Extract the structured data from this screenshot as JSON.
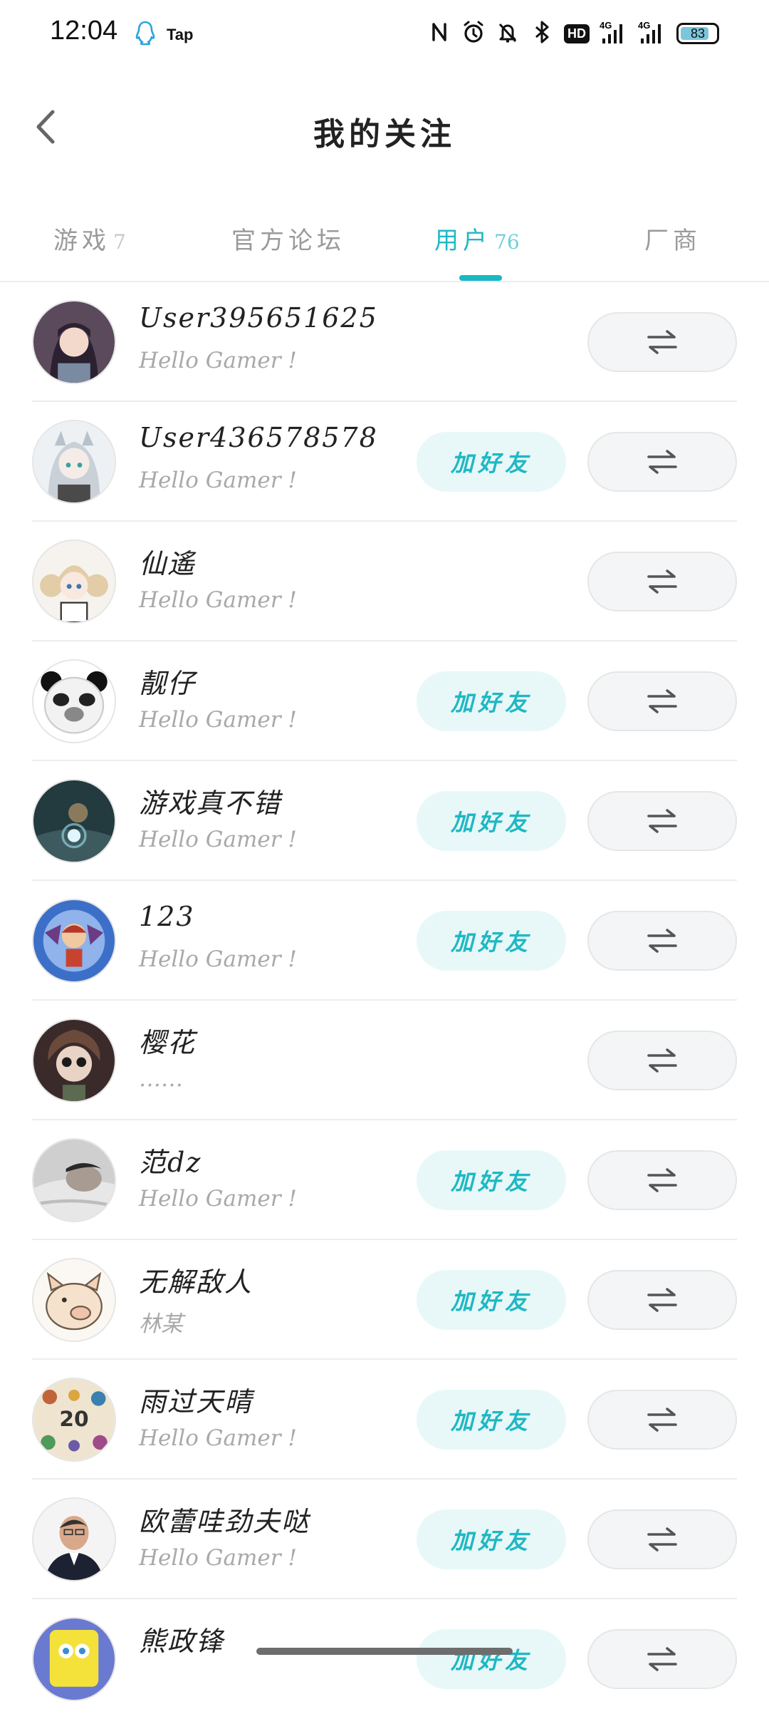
{
  "status_bar": {
    "time": "12:04",
    "tap_label": "Tap",
    "hd_label": "HD",
    "battery_level": "83",
    "icons": [
      "qq-icon",
      "nfc-icon",
      "alarm-icon",
      "mute-icon",
      "bluetooth-icon",
      "hd-icon",
      "signal-4g-icon",
      "signal-4g-icon",
      "battery-icon"
    ]
  },
  "header": {
    "title": "我的关注",
    "back_icon": "chevron-left-icon"
  },
  "tabs": [
    {
      "label": "游戏",
      "count": "7"
    },
    {
      "label": "官方论坛",
      "count": ""
    },
    {
      "label": "用户",
      "count": "76",
      "active": true
    },
    {
      "label": "厂商",
      "count": ""
    }
  ],
  "colors": {
    "accent": "#1fb8c3",
    "add_button_bg": "#e8f8f9",
    "swap_button_bg": "#f4f5f6"
  },
  "list": {
    "add_label": "加好友",
    "swap_icon": "swap-arrows-icon",
    "items": [
      {
        "name": "User395651625",
        "signature": "Hello Gamer !",
        "show_add": false
      },
      {
        "name": "User436578578",
        "signature": "Hello Gamer !",
        "show_add": true
      },
      {
        "name": "仙遙",
        "signature": "Hello Gamer !",
        "show_add": false
      },
      {
        "name": "靓仔",
        "signature": "Hello Gamer !",
        "show_add": true
      },
      {
        "name": "游戏真不错",
        "signature": "Hello Gamer !",
        "show_add": true
      },
      {
        "name": "123",
        "signature": "Hello Gamer !",
        "show_add": true
      },
      {
        "name": "樱花",
        "signature": "……",
        "show_add": false
      },
      {
        "name": "范dz",
        "signature": "Hello Gamer !",
        "show_add": true
      },
      {
        "name": "无解敌人",
        "signature": "林某",
        "show_add": true
      },
      {
        "name": "雨过天晴",
        "signature": "Hello Gamer !",
        "show_add": true
      },
      {
        "name": "欧蕾哇劲夫哒",
        "signature": "Hello Gamer !",
        "show_add": true
      },
      {
        "name": "熊政锋",
        "signature": "",
        "show_add": true
      }
    ]
  }
}
